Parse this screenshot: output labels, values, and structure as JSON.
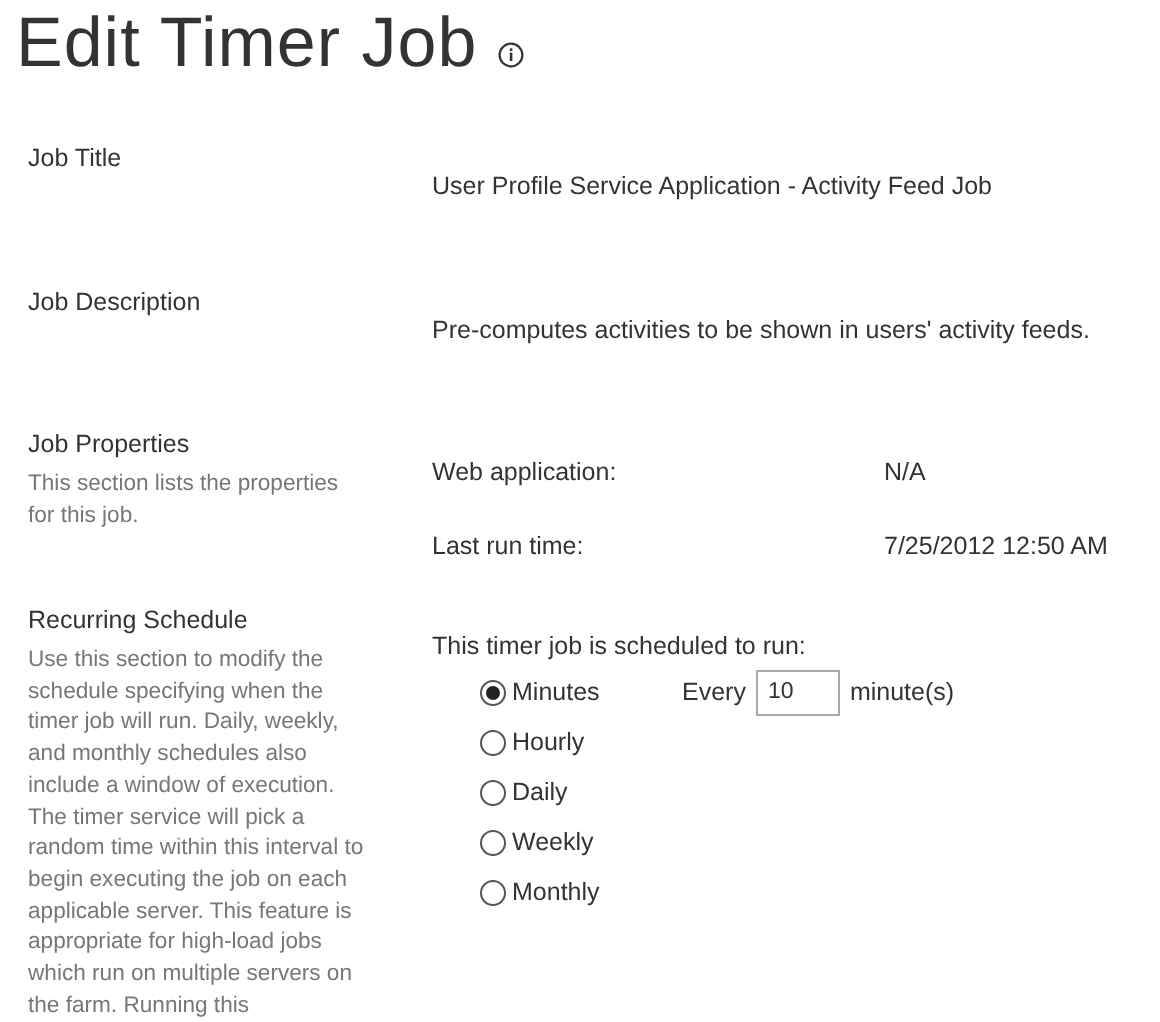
{
  "page_title": "Edit Timer Job",
  "sections": [
    {
      "kind": "text",
      "heading": "Job Title",
      "value": "User Profile Service Application - Activity Feed Job"
    },
    {
      "kind": "text",
      "heading": "Job Description",
      "value": "Pre-computes activities to be shown in users' activity feeds."
    },
    {
      "kind": "properties",
      "heading": "Job Properties",
      "description": "This section lists the properties for this job.",
      "properties": [
        {
          "label": "Web application:",
          "value": "N/A"
        },
        {
          "label": "Last run time:",
          "value": "7/25/2012 12:50 AM"
        }
      ]
    },
    {
      "kind": "schedule",
      "heading": "Recurring Schedule",
      "description": "Use this section to modify the schedule specifying when the timer job will run. Daily, weekly, and monthly schedules also include a window of execution. The timer service will pick a random time within this interval to begin executing the job on each applicable server. This feature is appropriate for high-load jobs which run on multiple servers on the farm. Running this",
      "prompt": "This timer job is scheduled to run:",
      "options": [
        {
          "label": "Minutes",
          "selected": true,
          "every_label": "Every",
          "every_value": "10",
          "unit": "minute(s)"
        },
        {
          "label": "Hourly",
          "selected": false
        },
        {
          "label": "Daily",
          "selected": false
        },
        {
          "label": "Weekly",
          "selected": false
        },
        {
          "label": "Monthly",
          "selected": false
        }
      ]
    }
  ]
}
